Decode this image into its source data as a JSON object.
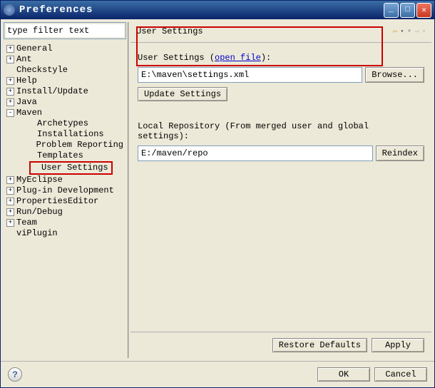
{
  "window": {
    "title": "Preferences"
  },
  "filter": {
    "placeholder": "type filter text"
  },
  "tree": {
    "items": [
      {
        "label": "General",
        "expander": "+",
        "depth": 0
      },
      {
        "label": "Ant",
        "expander": "+",
        "depth": 0
      },
      {
        "label": "Checkstyle",
        "expander": "",
        "depth": 0
      },
      {
        "label": "Help",
        "expander": "+",
        "depth": 0
      },
      {
        "label": "Install/Update",
        "expander": "+",
        "depth": 0
      },
      {
        "label": "Java",
        "expander": "+",
        "depth": 0
      },
      {
        "label": "Maven",
        "expander": "-",
        "depth": 0
      },
      {
        "label": "Archetypes",
        "expander": "",
        "depth": 1
      },
      {
        "label": "Installations",
        "expander": "",
        "depth": 1
      },
      {
        "label": "Problem Reporting",
        "expander": "",
        "depth": 1
      },
      {
        "label": "Templates",
        "expander": "",
        "depth": 1
      },
      {
        "label": "User Settings",
        "expander": "",
        "depth": 1,
        "highlighted": true
      },
      {
        "label": "MyEclipse",
        "expander": "+",
        "depth": 0
      },
      {
        "label": "Plug-in Development",
        "expander": "+",
        "depth": 0
      },
      {
        "label": "PropertiesEditor",
        "expander": "+",
        "depth": 0
      },
      {
        "label": "Run/Debug",
        "expander": "+",
        "depth": 0
      },
      {
        "label": "Team",
        "expander": "+",
        "depth": 0
      },
      {
        "label": "viPlugin",
        "expander": "",
        "depth": 0
      }
    ]
  },
  "page": {
    "title": "User Settings",
    "userSettingsLabel": "User Settings (",
    "openFile": "open file",
    "userSettingsLabelEnd": "):",
    "userSettingsValue": "E:\\maven\\settings.xml",
    "browse": "Browse...",
    "updateSettings": "Update Settings",
    "localRepoLabel": "Local Repository (From merged user and global settings):",
    "localRepoValue": "E:/maven/repo",
    "reindex": "Reindex",
    "restoreDefaults": "Restore Defaults",
    "apply": "Apply"
  },
  "footer": {
    "ok": "OK",
    "cancel": "Cancel"
  },
  "nav": {
    "back": "⇦",
    "backDrop": "▾",
    "forward": "⇨",
    "forwardDrop": "▾"
  },
  "colors": {
    "highlight": "#cc0000",
    "link": "#0000cc"
  }
}
